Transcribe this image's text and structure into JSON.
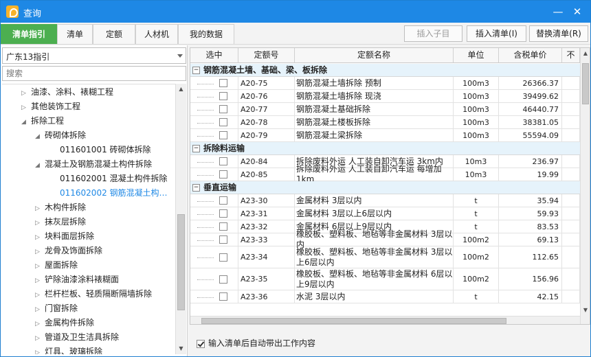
{
  "window": {
    "title": "查询"
  },
  "tabs": [
    {
      "label": "清单指引"
    },
    {
      "label": "清单"
    },
    {
      "label": "定额"
    },
    {
      "label": "人材机"
    },
    {
      "label": "我的数据"
    }
  ],
  "actions": {
    "insert_sub": "插入子目",
    "insert_list": "插入清单(I)",
    "replace_list": "替换清单(R)"
  },
  "left": {
    "selector_value": "广东13指引",
    "search_placeholder": "搜索",
    "tree": [
      {
        "label": "油漆、涂料、裱糊工程",
        "expanded": false
      },
      {
        "label": "其他装饰工程",
        "expanded": false
      },
      {
        "label": "拆除工程",
        "expanded": true
      },
      {
        "label": "砖砌体拆除",
        "expanded": true
      },
      {
        "label": "011601001  砖砌体拆除",
        "expanded": null
      },
      {
        "label": "混凝土及钢筋混凝土构件拆除",
        "expanded": true
      },
      {
        "label": "011602001  混凝土构件拆除",
        "expanded": null
      },
      {
        "label": "011602002  钢筋混凝土构…",
        "expanded": null,
        "selected": true
      },
      {
        "label": "木构件拆除",
        "expanded": false
      },
      {
        "label": "抹灰层拆除",
        "expanded": false
      },
      {
        "label": "块料面层拆除",
        "expanded": false
      },
      {
        "label": "龙骨及饰面拆除",
        "expanded": false
      },
      {
        "label": "屋面拆除",
        "expanded": false
      },
      {
        "label": "铲除油漆涂料裱糊面",
        "expanded": false
      },
      {
        "label": "栏杆栏板、轻质隔断隔墙拆除",
        "expanded": false
      },
      {
        "label": "门窗拆除",
        "expanded": false
      },
      {
        "label": "金属构件拆除",
        "expanded": false
      },
      {
        "label": "管道及卫生洁具拆除",
        "expanded": false
      },
      {
        "label": "灯具、玻璃拆除",
        "expanded": false
      }
    ]
  },
  "grid": {
    "headers": [
      "选中",
      "定额号",
      "定额名称",
      "单位",
      "含税单价",
      "不"
    ],
    "groups": [
      {
        "title": "钢筋混凝土墙、基础、梁、板拆除",
        "rows": [
          {
            "code": "A20-75",
            "name": "钢筋混凝土墙拆除 预制",
            "unit": "100m3",
            "price": "26366.37"
          },
          {
            "code": "A20-76",
            "name": "钢筋混凝土墙拆除 现浇",
            "unit": "100m3",
            "price": "39499.62"
          },
          {
            "code": "A20-77",
            "name": "钢筋混凝土基础拆除",
            "unit": "100m3",
            "price": "46440.77"
          },
          {
            "code": "A20-78",
            "name": "钢筋混凝土楼板拆除",
            "unit": "100m3",
            "price": "38381.05"
          },
          {
            "code": "A20-79",
            "name": "钢筋混凝土梁拆除",
            "unit": "100m3",
            "price": "55594.09"
          }
        ]
      },
      {
        "title": "拆除料运输",
        "rows": [
          {
            "code": "A20-84",
            "name": "拆除废料外运 人工装自卸汽车运 3km内",
            "unit": "10m3",
            "price": "236.97"
          },
          {
            "code": "A20-85",
            "name": "拆除废料外运 人工装自卸汽车运 每增加1km",
            "unit": "10m3",
            "price": "19.99"
          }
        ]
      },
      {
        "title": "垂直运输",
        "rows": [
          {
            "code": "A23-30",
            "name": "金属材料 3层以内",
            "unit": "t",
            "price": "35.94"
          },
          {
            "code": "A23-31",
            "name": "金属材料 3层以上6层以内",
            "unit": "t",
            "price": "59.93"
          },
          {
            "code": "A23-32",
            "name": "金属材料 6层以上9层以内",
            "unit": "t",
            "price": "83.53"
          },
          {
            "code": "A23-33",
            "name": "橡胶板、塑料板、地毡等非金属材料 3层以内",
            "unit": "100m2",
            "price": "69.13"
          },
          {
            "code": "A23-34",
            "name": "橡胶板、塑料板、地毡等非金属材料 3层以上6层以内",
            "unit": "100m2",
            "price": "112.65"
          },
          {
            "code": "A23-35",
            "name": "橡胶板、塑料板、地毡等非金属材料 6层以上9层以内",
            "unit": "100m2",
            "price": "156.96"
          },
          {
            "code": "A23-36",
            "name": "水泥 3层以内",
            "unit": "t",
            "price": "42.15"
          }
        ]
      }
    ]
  },
  "footer": {
    "auto_label": "输入清单后自动带出工作内容",
    "auto_checked": true
  }
}
